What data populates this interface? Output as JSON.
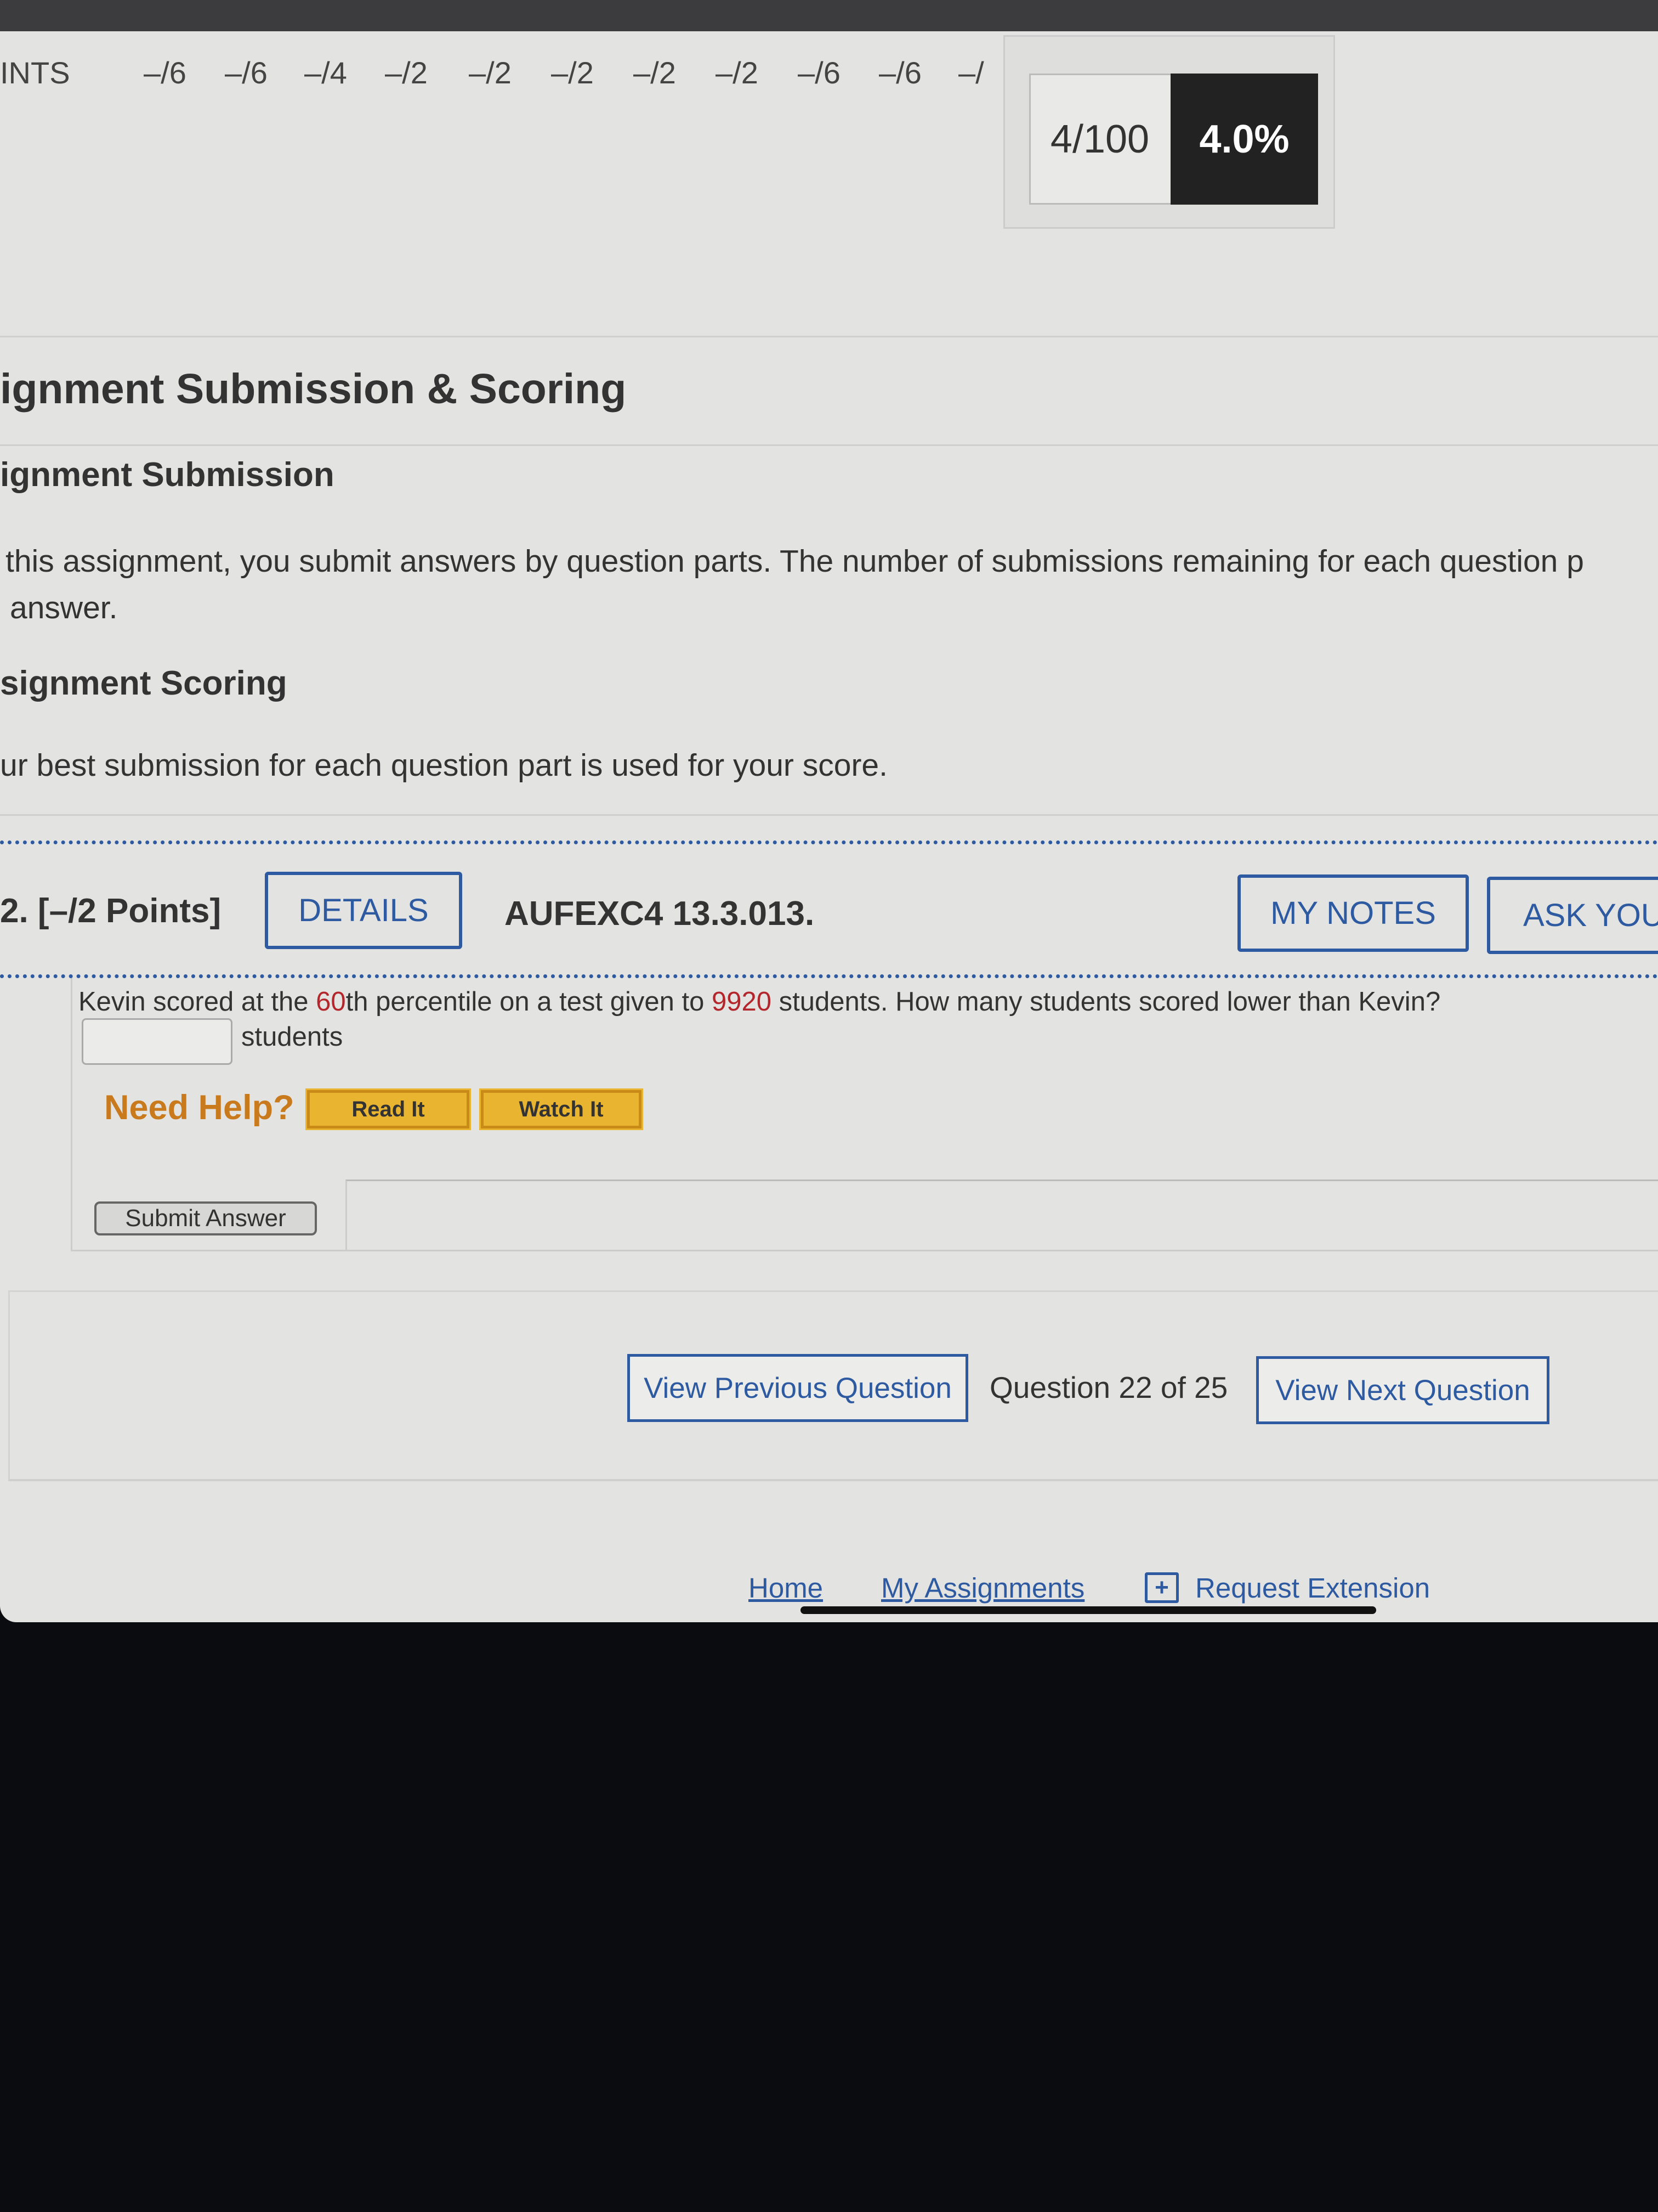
{
  "points_row": {
    "label": "INTS",
    "values": [
      "–/6",
      "–/6",
      "–/4",
      "–/2",
      "–/2",
      "–/2",
      "–/2",
      "–/2",
      "–/6",
      "–/6",
      "–/"
    ]
  },
  "score": {
    "fraction": "4/100",
    "percent": "4.0%"
  },
  "section": {
    "title": "ignment Submission & Scoring",
    "submission_heading": "ignment Submission",
    "submission_text_1": "this assignment, you submit answers by question parts. The number of submissions remaining for each question p",
    "submission_text_2": "answer.",
    "scoring_heading": "signment Scoring",
    "scoring_text": "ur best submission for each question part is used for your score."
  },
  "question": {
    "number_points": "2. [–/2 Points]",
    "details_label": "DETAILS",
    "code": "AUFEXC4 13.3.013.",
    "my_notes_label": "MY NOTES",
    "ask_label": "ASK YOU",
    "text_parts": [
      "Kevin scored at the ",
      "60",
      "th percentile on a test given to ",
      "9920",
      " students. How many students scored lower than Kevin?"
    ],
    "answer_value": "",
    "answer_unit": "students",
    "need_help": "Need Help?",
    "read_it": "Read It",
    "watch_it": "Watch It",
    "submit_label": "Submit Answer"
  },
  "nav": {
    "prev": "View Previous Question",
    "position": "Question 22 of 25",
    "next": "View Next Question"
  },
  "footer": {
    "home": "Home",
    "assignments": "My Assignments",
    "extension": "Request Extension"
  },
  "colors": {
    "link": "#2d5aa0",
    "highlight": "#b3262b",
    "help": "#c97a1c",
    "button": "#e9b430"
  }
}
